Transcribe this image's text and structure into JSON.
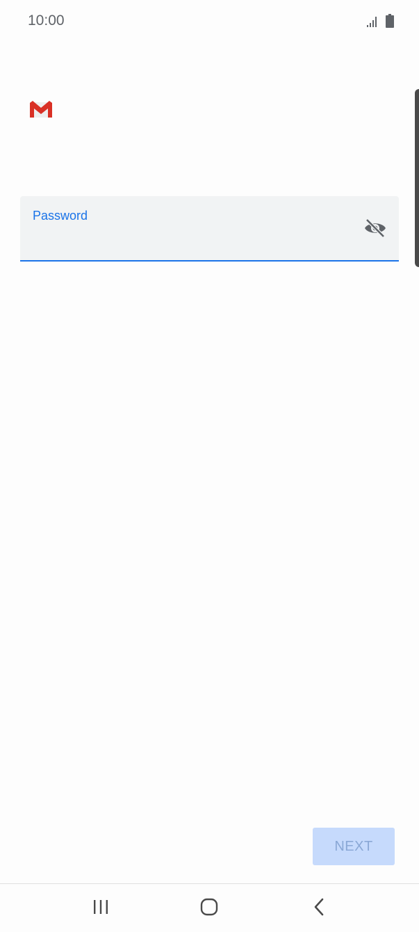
{
  "status_bar": {
    "time": "10:00",
    "icons": [
      "signal-icon",
      "battery-icon"
    ]
  },
  "app": {
    "logo": "gmail-logo",
    "brand_color": "#d93025"
  },
  "password_field": {
    "label": "Password",
    "value": "",
    "toggle_icon": "visibility-off-icon",
    "accent_color": "#1a73e8"
  },
  "actions": {
    "next_label": "NEXT",
    "next_enabled": false
  },
  "nav_bar": {
    "buttons": [
      "recent-apps-icon",
      "home-icon",
      "back-icon"
    ]
  }
}
